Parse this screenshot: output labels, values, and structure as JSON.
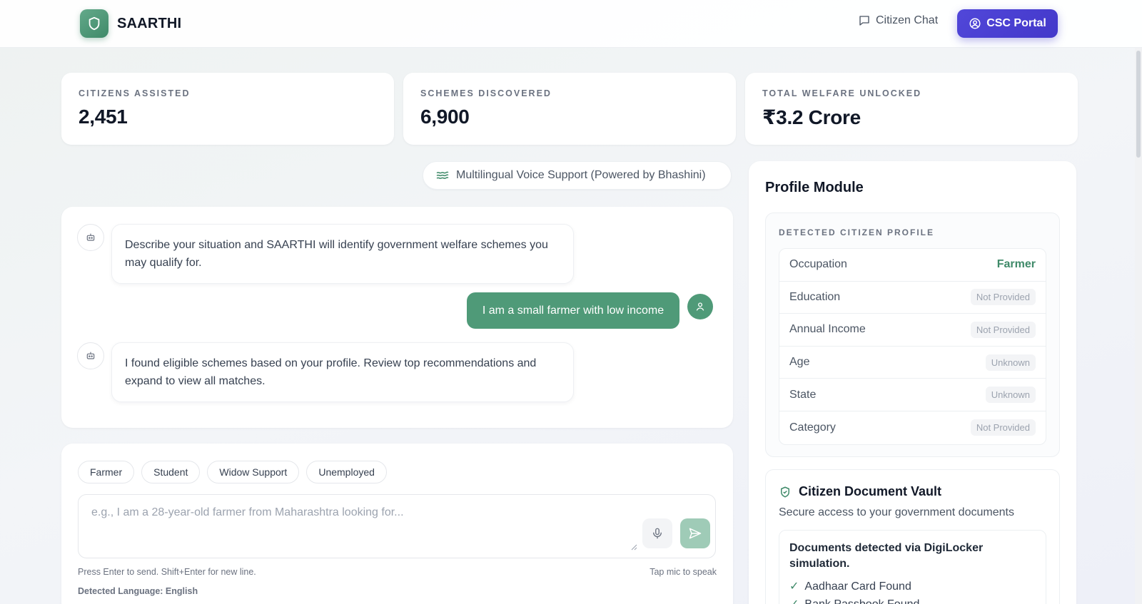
{
  "brand": {
    "name": "SAARTHI"
  },
  "nav": {
    "chat_label": "Citizen Chat",
    "portal_label": "CSC Portal"
  },
  "stats": [
    {
      "label": "CITIZENS ASSISTED",
      "value": "2,451"
    },
    {
      "label": "SCHEMES DISCOVERED",
      "value": "6,900"
    },
    {
      "label": "TOTAL WELFARE UNLOCKED",
      "value": "₹3.2 Crore"
    }
  ],
  "voice": {
    "label": "Multilingual Voice Support (Powered by Bhashini)"
  },
  "chat": {
    "messages": [
      {
        "role": "bot",
        "text": "Describe your situation and SAARTHI will identify government welfare schemes you may qualify for."
      },
      {
        "role": "user",
        "text": "I am a small farmer with low income"
      },
      {
        "role": "bot",
        "text": "I found eligible schemes based on your profile. Review top recommendations and expand to view all matches."
      }
    ]
  },
  "composer": {
    "chips": [
      "Farmer",
      "Student",
      "Widow Support",
      "Unemployed"
    ],
    "placeholder": "e.g., I am a 28-year-old farmer from Maharashtra looking for...",
    "hint_left": "Press Enter to send. Shift+Enter for new line.",
    "hint_right": "Tap mic to speak",
    "detected_language": "Detected Language: English"
  },
  "profile": {
    "title": "Profile Module",
    "section_label": "DETECTED CITIZEN PROFILE",
    "rows": [
      {
        "key": "Occupation",
        "value": "Farmer",
        "style": "strong"
      },
      {
        "key": "Education",
        "value": "Not Provided",
        "style": "tag"
      },
      {
        "key": "Annual Income",
        "value": "Not Provided",
        "style": "tag"
      },
      {
        "key": "Age",
        "value": "Unknown",
        "style": "tag"
      },
      {
        "key": "State",
        "value": "Unknown",
        "style": "tag"
      },
      {
        "key": "Category",
        "value": "Not Provided",
        "style": "tag"
      }
    ]
  },
  "vault": {
    "title": "Citizen Document Vault",
    "subtitle": "Secure access to your government documents",
    "detected_title": "Documents detected via DigiLocker simulation.",
    "items": [
      "Aadhaar Card Found",
      "Bank Passbook Found"
    ]
  },
  "colors": {
    "brand_green": "#4f9a78",
    "accent_indigo": "#4338ca"
  }
}
